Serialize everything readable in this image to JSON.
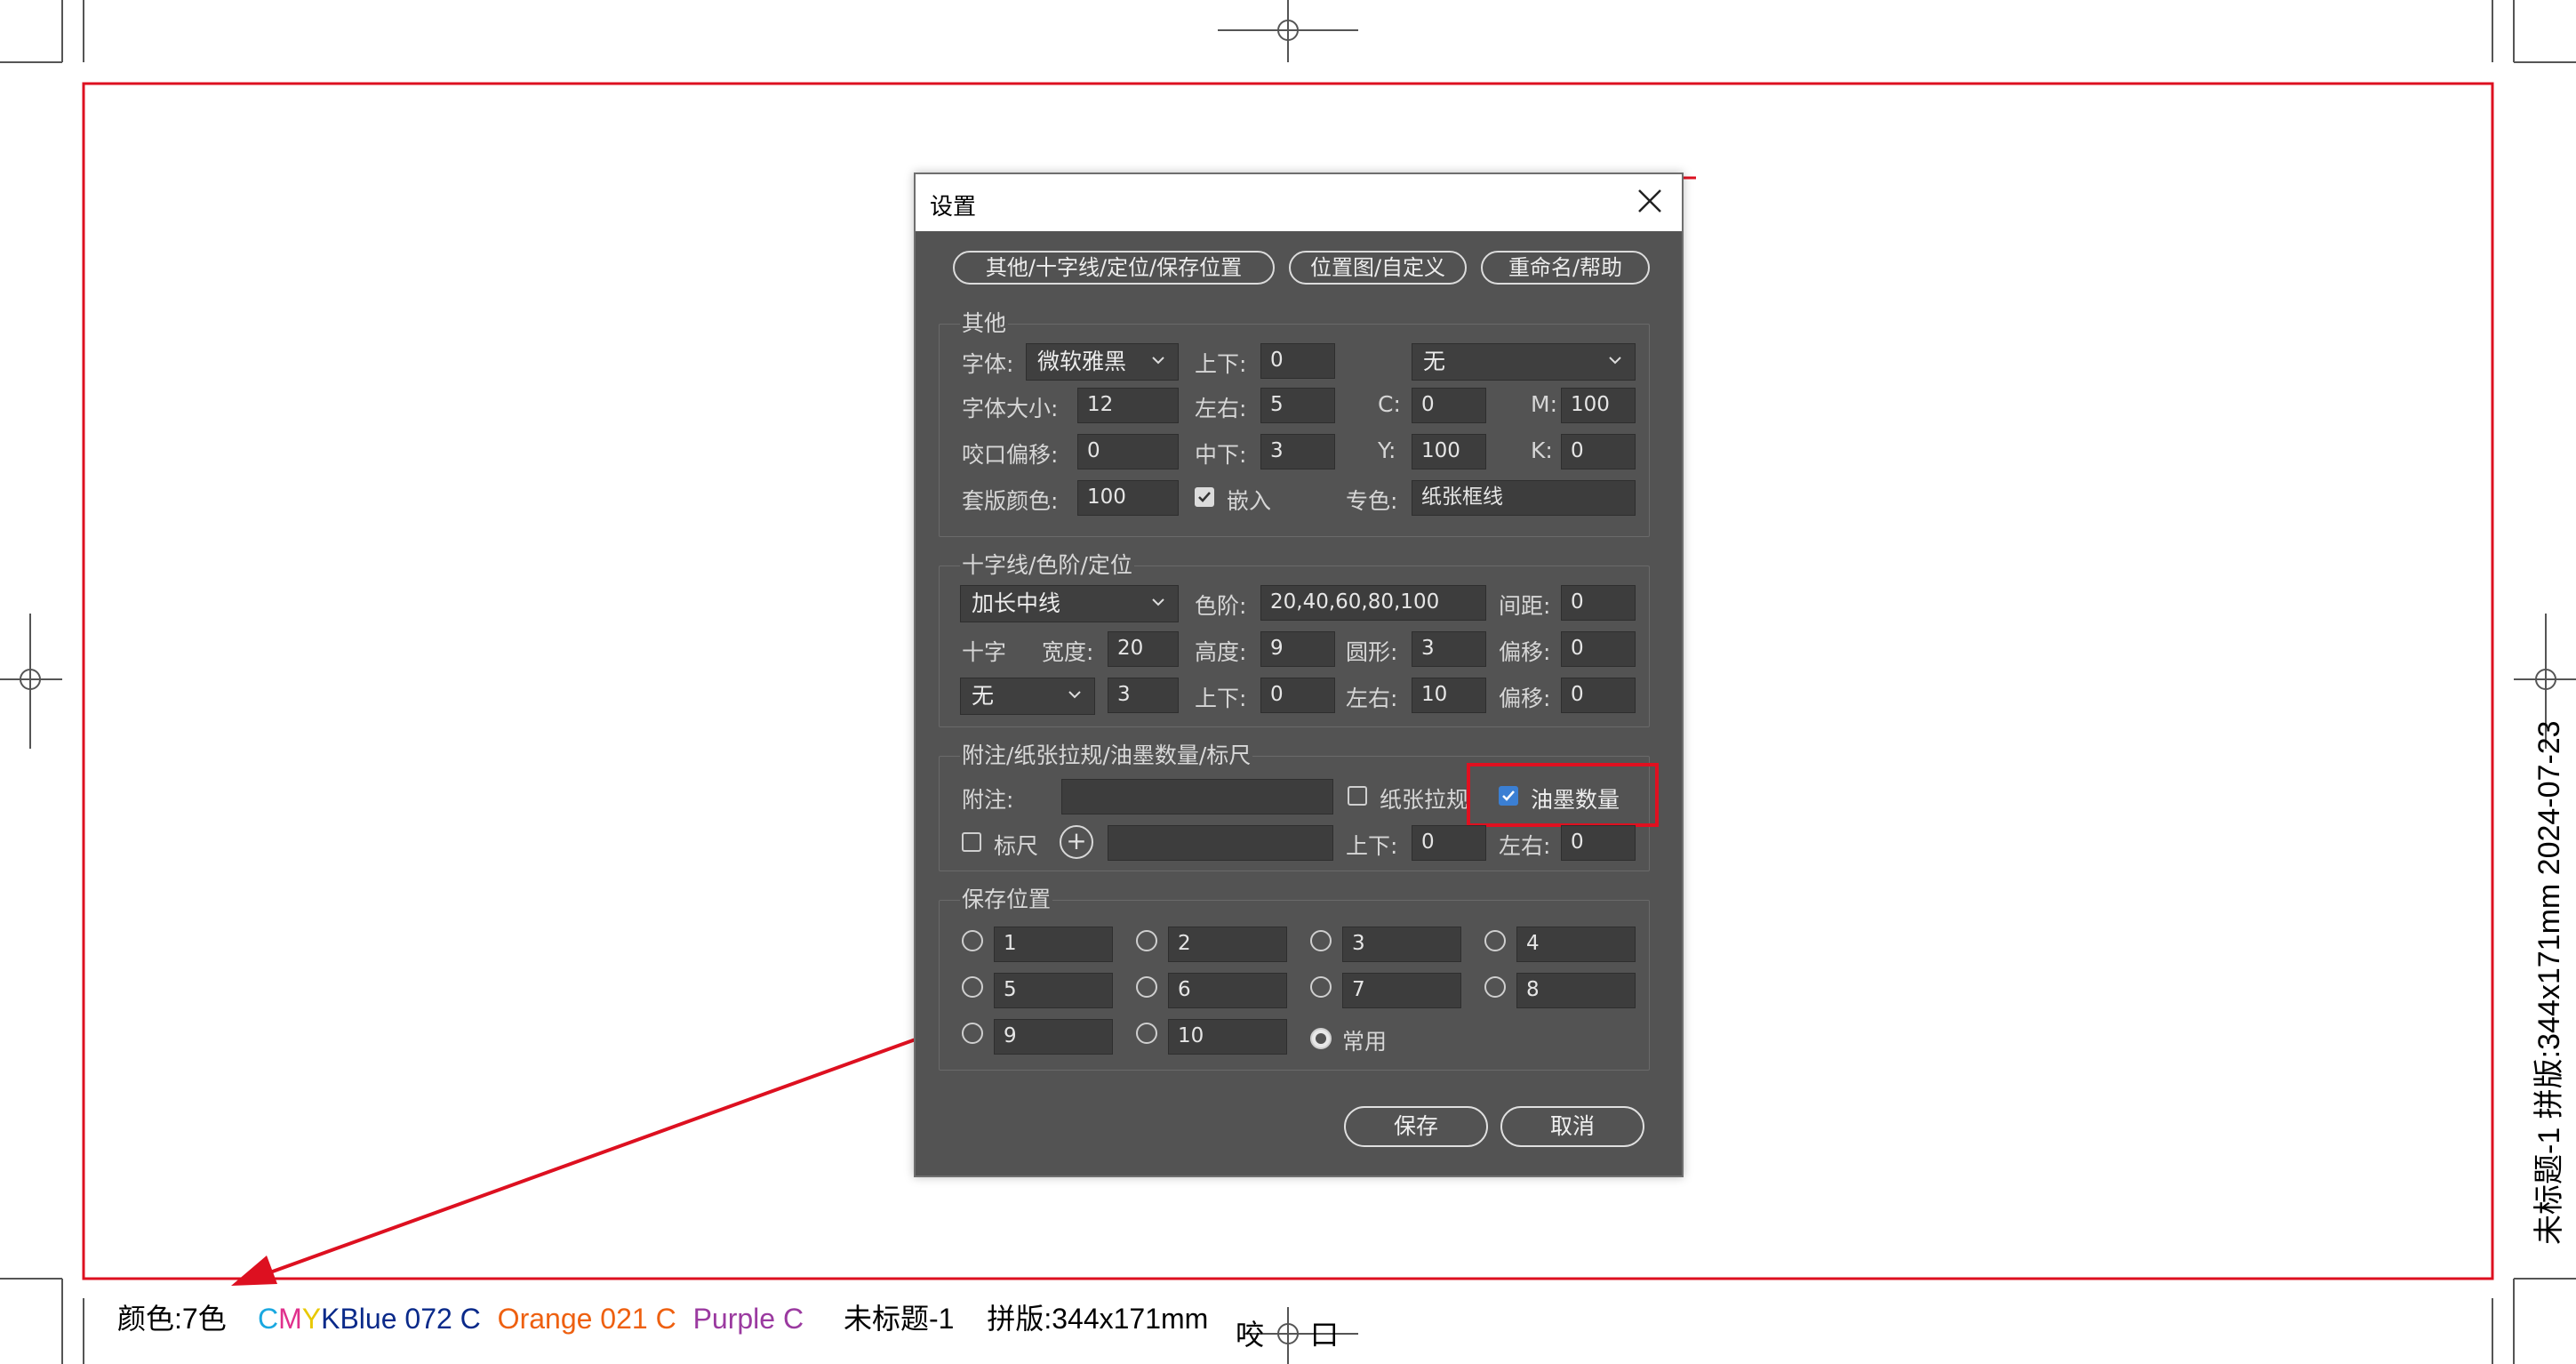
{
  "dialog": {
    "title": "设置",
    "tabs": [
      "其他/十字线/定位/保存位置",
      "位置图/自定义",
      "重命名/帮助"
    ],
    "other": {
      "legend": "其他",
      "font_label": "字体:",
      "font_value": "微软雅黑",
      "updown_label": "上下:",
      "updown_value": "0",
      "none_select": "无",
      "fontsize_label": "字体大小:",
      "fontsize_value": "12",
      "leftright_label": "左右:",
      "leftright_value": "5",
      "c_label": "C:",
      "c_value": "0",
      "m_label": "M:",
      "m_value": "100",
      "bite_label": "咬口偏移:",
      "bite_value": "0",
      "middown_label": "中下:",
      "middown_value": "3",
      "y_label": "Y:",
      "y_value": "100",
      "k_label": "K:",
      "k_value": "0",
      "reg_label": "套版颜色:",
      "reg_value": "100",
      "embed_label": "嵌入",
      "spot_label": "专色:",
      "spot_value": "纸张框线"
    },
    "cross": {
      "legend": "十字线/色阶/定位",
      "type_select": "加长中线",
      "levels_label": "色阶:",
      "levels_value": "20,40,60,80,100",
      "gap_label": "间距:",
      "gap_value": "0",
      "cross_label": "十字",
      "width_label": "宽度:",
      "width_value": "20",
      "height_label": "高度:",
      "height_value": "9",
      "circle_label": "圆形:",
      "circle_value": "3",
      "offset_label": "偏移:",
      "offset_value": "0",
      "none_select": "无",
      "small_value": "3",
      "updown_label": "上下:",
      "updown_value": "0",
      "leftright_label": "左右:",
      "leftright_value": "10",
      "offset2_label": "偏移:",
      "offset2_value": "0"
    },
    "notes": {
      "legend": "附注/纸张拉规/油墨数量/标尺",
      "note_label": "附注:",
      "note_value": "",
      "paper_label": "纸张拉规",
      "ink_label": "油墨数量",
      "ruler_label": "标尺",
      "plus": "+",
      "ruler_value": "",
      "updown_label": "上下:",
      "updown_value": "0",
      "leftright_label": "左右:",
      "leftright_value": "0"
    },
    "save": {
      "legend": "保存位置",
      "slots": [
        "1",
        "2",
        "3",
        "4",
        "5",
        "6",
        "7",
        "8",
        "9",
        "10"
      ],
      "common_label": "常用"
    },
    "save_button": "保存",
    "cancel_button": "取消"
  },
  "info": {
    "colors_label": "颜色:7色",
    "c": "C",
    "m": "M",
    "y": "Y",
    "k": "K",
    "blue": "Blue 072 C",
    "orange": "Orange 021 C",
    "purple": "Purple C",
    "title": "未标题-1",
    "imposition": "拼版:344x171mm"
  },
  "side_text": "未标题-1   拼版:344x171mm   2024-07-23",
  "bottom_mark_left": "咬",
  "bottom_mark_right": "口",
  "colors": {
    "cyan": "#1aa8e0",
    "magenta": "#e0308c",
    "yellow": "#e8c800",
    "blue": "#0a2a8a",
    "orange": "#ee6010",
    "purple": "#9b3aa0",
    "frame_red": "#dd1020"
  }
}
